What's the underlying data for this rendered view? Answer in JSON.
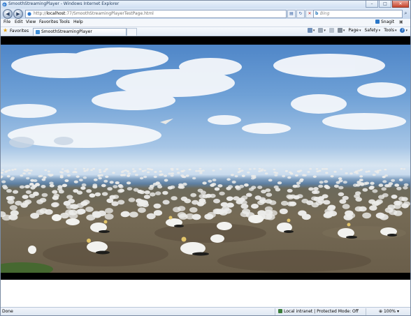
{
  "window": {
    "title": "SmoothStreamingPlayer - Windows Internet Explorer",
    "controls": {
      "minimize": "–",
      "maximize": "□",
      "close": "✕"
    }
  },
  "address_bar": {
    "url_prefix": "http://",
    "url_host": "localhost",
    "url_rest": ":77/SmoothStreamingPlayerTestPage.html"
  },
  "search": {
    "engine": "b",
    "placeholder": "Bing"
  },
  "menu": [
    "File",
    "Edit",
    "View",
    "Favorites",
    "Tools",
    "Help"
  ],
  "snagit": {
    "label": "Snagit"
  },
  "favorites_bar": {
    "label": "Favorites"
  },
  "tab": {
    "label": "SmoothStreamingPlayer"
  },
  "command_bar": {
    "page": "Page",
    "safety": "Safety",
    "tools": "Tools",
    "help": "?"
  },
  "status_bar": {
    "status": "Done",
    "zone": "Local intranet | Protected Mode: Off",
    "zoom": "100%"
  },
  "icons": {
    "back": "back-arrow-icon",
    "forward": "forward-arrow-icon",
    "refresh": "refresh-icon",
    "stop": "stop-icon",
    "search": "search-icon"
  },
  "colors": {
    "accent": "#2c5aa0",
    "close_button": "#c8452d",
    "favorites_star": "#e6a516"
  }
}
